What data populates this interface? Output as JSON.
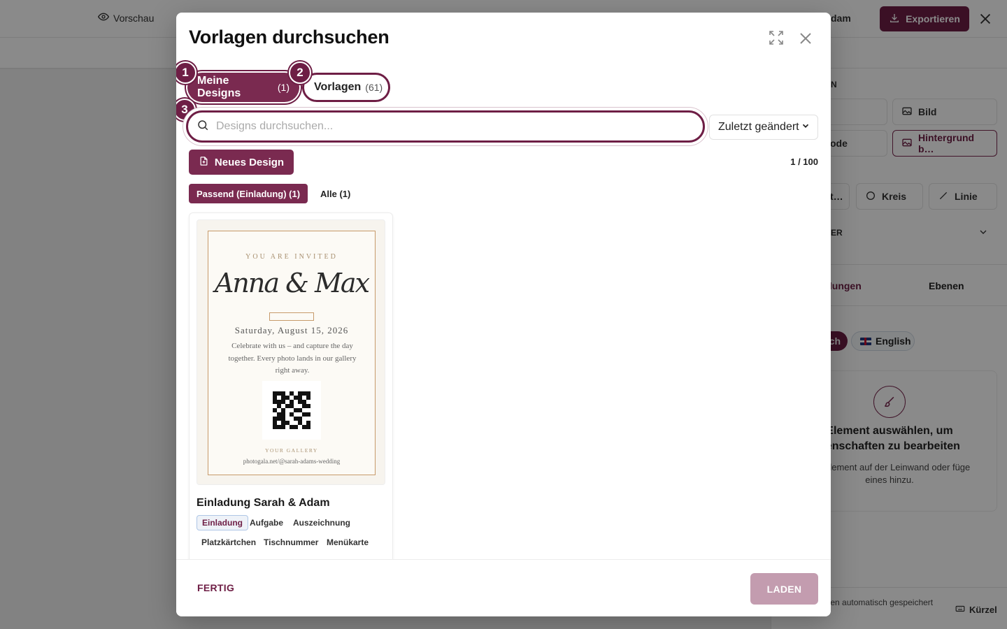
{
  "background": {
    "preview_label": "Vorschau",
    "title_fragment": "dam",
    "export_label": "Exportieren",
    "section_fragment": "N",
    "buttons": {
      "image": "Bild",
      "mode": "ode",
      "background": "Hintergrund b…",
      "text": "t…",
      "circle": "Kreis",
      "line": "Linie"
    },
    "layer_section": "ER",
    "tabs": {
      "settings": "llungen",
      "layers": "Ebenen"
    },
    "languages": {
      "de": "ch",
      "en": "English"
    },
    "empty_state": {
      "title": "Element auswählen, um genschaften zu bearbeiten",
      "text": "ein Element auf der Leinwand oder füge eines hinzu."
    },
    "autosave": "gen werden automatisch gespeichert",
    "shortcuts": "Kürzel"
  },
  "modal": {
    "title": "Vorlagen durchsuchen",
    "tabs": {
      "mine": {
        "label": "Meine Designs",
        "count": "(1)"
      },
      "templates": {
        "label": "Vorlagen",
        "count": "(61)"
      }
    },
    "steps": [
      "1",
      "2",
      "3"
    ],
    "search": {
      "placeholder": "Designs durchsuchen...",
      "value": ""
    },
    "sort": {
      "selected": "Zuletzt geändert"
    },
    "new_design": "Neues Design",
    "page_count": "1 / 100",
    "filters": {
      "matching": "Passend (Einladung) (1)",
      "all": "Alle (1)"
    },
    "card": {
      "title": "Einladung Sarah & Adam",
      "tags": [
        "Einladung",
        "Aufgabe",
        "Auszeichnung",
        "Platzkärtchen",
        "Tischnummer",
        "Menükarte"
      ],
      "preview": {
        "kicker": "YOU ARE INVITED",
        "names": "Anna & Max",
        "date": "Saturday, August 15, 2026",
        "text": "Celebrate with us – and capture the day together. Every photo lands in our gallery right away.",
        "gallery": "YOUR GALLERY",
        "url": "photogala.net/@sarah-adams-wedding"
      }
    },
    "footer": {
      "done": "FERTIG",
      "load": "LADEN"
    }
  },
  "colors": {
    "brand": "#6e1e45",
    "brand_muted": "#c39caf",
    "tag_selected_bg": "#eef2f8"
  }
}
